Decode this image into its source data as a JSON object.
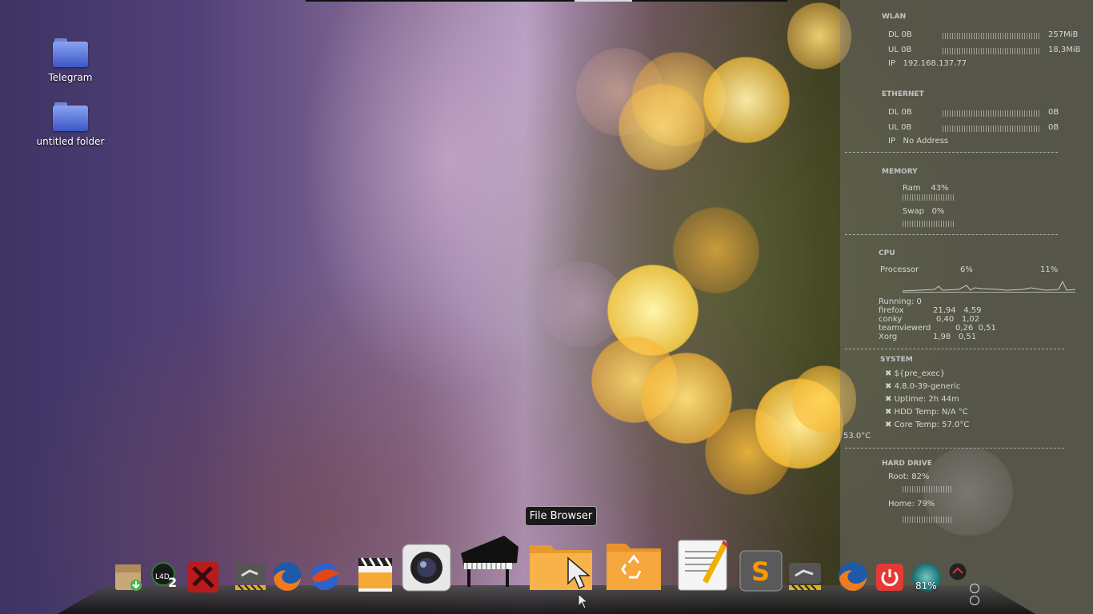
{
  "desktop": {
    "icons": [
      {
        "label": "Telegram"
      },
      {
        "label": "untitled folder"
      }
    ]
  },
  "conky": {
    "wlan": {
      "heading": "WLAN",
      "dl_label": "DL",
      "dl_value": "0B",
      "dl_total": "257MiB",
      "ul_label": "UL",
      "ul_value": "0B",
      "ul_total": "18,3MiB",
      "ip_label": "IP",
      "ip_value": "192.168.137.77"
    },
    "ethernet": {
      "heading": "ETHERNET",
      "dl_label": "DL",
      "dl_value": "0B",
      "dl_total": "0B",
      "ul_label": "UL",
      "ul_value": "0B",
      "ul_total": "0B",
      "ip_label": "IP",
      "ip_value": "No Address"
    },
    "memory": {
      "heading": "MEMORY",
      "ram_label": "Ram",
      "ram_value": "43%",
      "swap_label": "Swap",
      "swap_value": "0%"
    },
    "cpu": {
      "heading": "CPU",
      "processor_label": "Processor",
      "processor_value": "6%",
      "processor_peak": "11%",
      "running": "Running:  0",
      "processes": [
        {
          "name": "firefox",
          "a": "21,94",
          "b": "4,59"
        },
        {
          "name": "conky",
          "a": "0,40",
          "b": "1,02"
        },
        {
          "name": "teamviewerd",
          "a": "0,26",
          "b": "0,51"
        },
        {
          "name": "Xorg",
          "a": "1,98",
          "b": "0,51"
        }
      ]
    },
    "system": {
      "heading": "SYSTEM",
      "lines": [
        "${pre_exec}",
        "4.8.0-39-generic",
        "Uptime: 2h 44m",
        "HDD Temp:  N/A °C",
        "Core Temp:  57.0°C"
      ],
      "side_temp": "53.0°C"
    },
    "harddrive": {
      "heading": "HARD DRIVE",
      "root": "Root: 82%",
      "home": "Home: 79%"
    }
  },
  "dock": {
    "tooltip": "File Browser",
    "battery": "81%",
    "items": [
      {
        "icon": "package-installer-icon"
      },
      {
        "icon": "left4dead2-icon"
      },
      {
        "icon": "dota2-icon"
      },
      {
        "icon": "steam-icon"
      },
      {
        "icon": "firefox-icon"
      },
      {
        "icon": "thunderbird-icon"
      },
      {
        "icon": "video-editor-icon"
      },
      {
        "icon": "camera-icon"
      },
      {
        "icon": "piano-icon"
      },
      {
        "icon": "file-browser-icon"
      },
      {
        "icon": "trash-icon"
      },
      {
        "icon": "text-editor-icon"
      },
      {
        "icon": "sublime-text-icon"
      },
      {
        "icon": "steam-icon"
      },
      {
        "icon": "firefox-icon"
      },
      {
        "icon": "power-icon"
      },
      {
        "icon": "battery-globe-icon"
      },
      {
        "icon": "network-indicator-icon"
      }
    ]
  }
}
